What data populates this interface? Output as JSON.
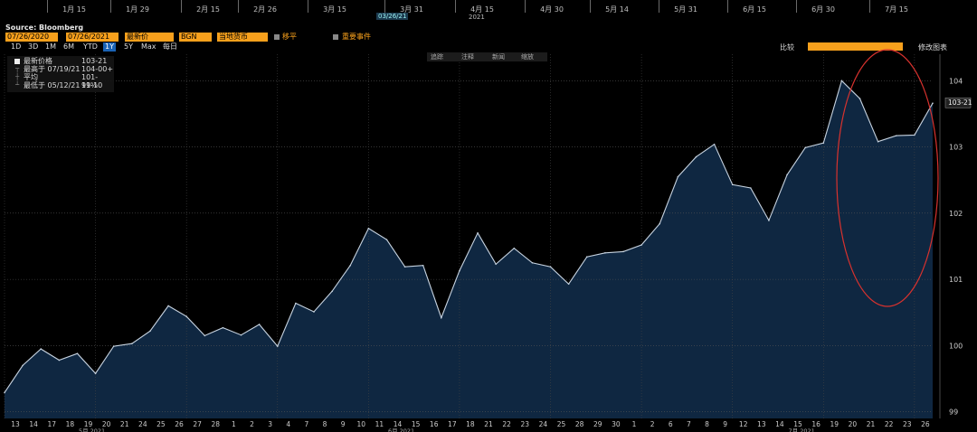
{
  "header": {
    "source": "Source: Bloomberg",
    "start_date": "07/26/2020",
    "end_date": "07/26/2021",
    "price_field": "最新价",
    "source_code": "BGN",
    "currency": "当地货币",
    "move_label": "移平",
    "events_label": "重要事件",
    "compare_label": "比较",
    "modify_label": "修改图表",
    "highlight_date": "03/26/21",
    "top_year": "2021"
  },
  "periods": [
    "1D",
    "3D",
    "1M",
    "6M",
    "YTD",
    "1Y",
    "5Y",
    "Max",
    "每日"
  ],
  "active_period": "1Y",
  "tools": [
    "追踪",
    "注释",
    "新闻",
    "缩放"
  ],
  "legend": [
    {
      "label": "最新价格",
      "value": "103-21"
    },
    {
      "label": "最高于 07/19/21",
      "value": "104-00+"
    },
    {
      "label": "平均",
      "value": "101-11⅝"
    },
    {
      "label": "最低于 05/12/21",
      "value": "99-10"
    }
  ],
  "top_axis_labels": [
    "1月 15",
    "1月 29",
    "2月 15",
    "2月 26",
    "3月 15",
    "3月 31",
    "4月 15",
    "4月 30",
    "5月 14",
    "5月 31",
    "6月 15",
    "6月 30",
    "7月 15"
  ],
  "last_price_label": "103-21",
  "colors": {
    "area": "#0f2741",
    "line": "#c7d3e0",
    "grid": "#3a3a3a",
    "annotation": "#d8322e"
  },
  "chart_data": {
    "type": "area",
    "x": [
      "13",
      "14",
      "17",
      "18",
      "19",
      "20",
      "21",
      "24",
      "25",
      "26",
      "27",
      "28",
      "1",
      "2",
      "3",
      "4",
      "7",
      "8",
      "9",
      "10",
      "11",
      "14",
      "15",
      "16",
      "17",
      "18",
      "21",
      "22",
      "23",
      "24",
      "25",
      "28",
      "29",
      "30",
      "1",
      "2",
      "6",
      "7",
      "8",
      "9",
      "12",
      "13",
      "14",
      "15",
      "16",
      "19",
      "20",
      "21",
      "22",
      "23",
      "26"
    ],
    "y": [
      99.29,
      99.7,
      99.95,
      99.78,
      99.88,
      99.58,
      99.99,
      100.03,
      100.22,
      100.6,
      100.44,
      100.15,
      100.27,
      100.16,
      100.32,
      99.99,
      100.64,
      100.51,
      100.82,
      101.21,
      101.77,
      101.6,
      101.19,
      101.21,
      100.42,
      101.13,
      101.7,
      101.23,
      101.47,
      101.25,
      101.19,
      100.93,
      101.34,
      101.4,
      101.42,
      101.52,
      101.84,
      102.55,
      102.85,
      103.04,
      102.43,
      102.38,
      101.89,
      102.58,
      102.99,
      103.06,
      104.0,
      103.73,
      103.08,
      103.17,
      103.18,
      103.66
    ],
    "series": [
      {
        "name": "最新价格",
        "values": []
      }
    ],
    "x_groups": [
      "5月 2021",
      "6月 2021",
      "7月 2021"
    ],
    "yticks": [
      99,
      100,
      101,
      102,
      103,
      104
    ],
    "ylim": [
      98.9,
      104.4
    ],
    "grid": true
  }
}
